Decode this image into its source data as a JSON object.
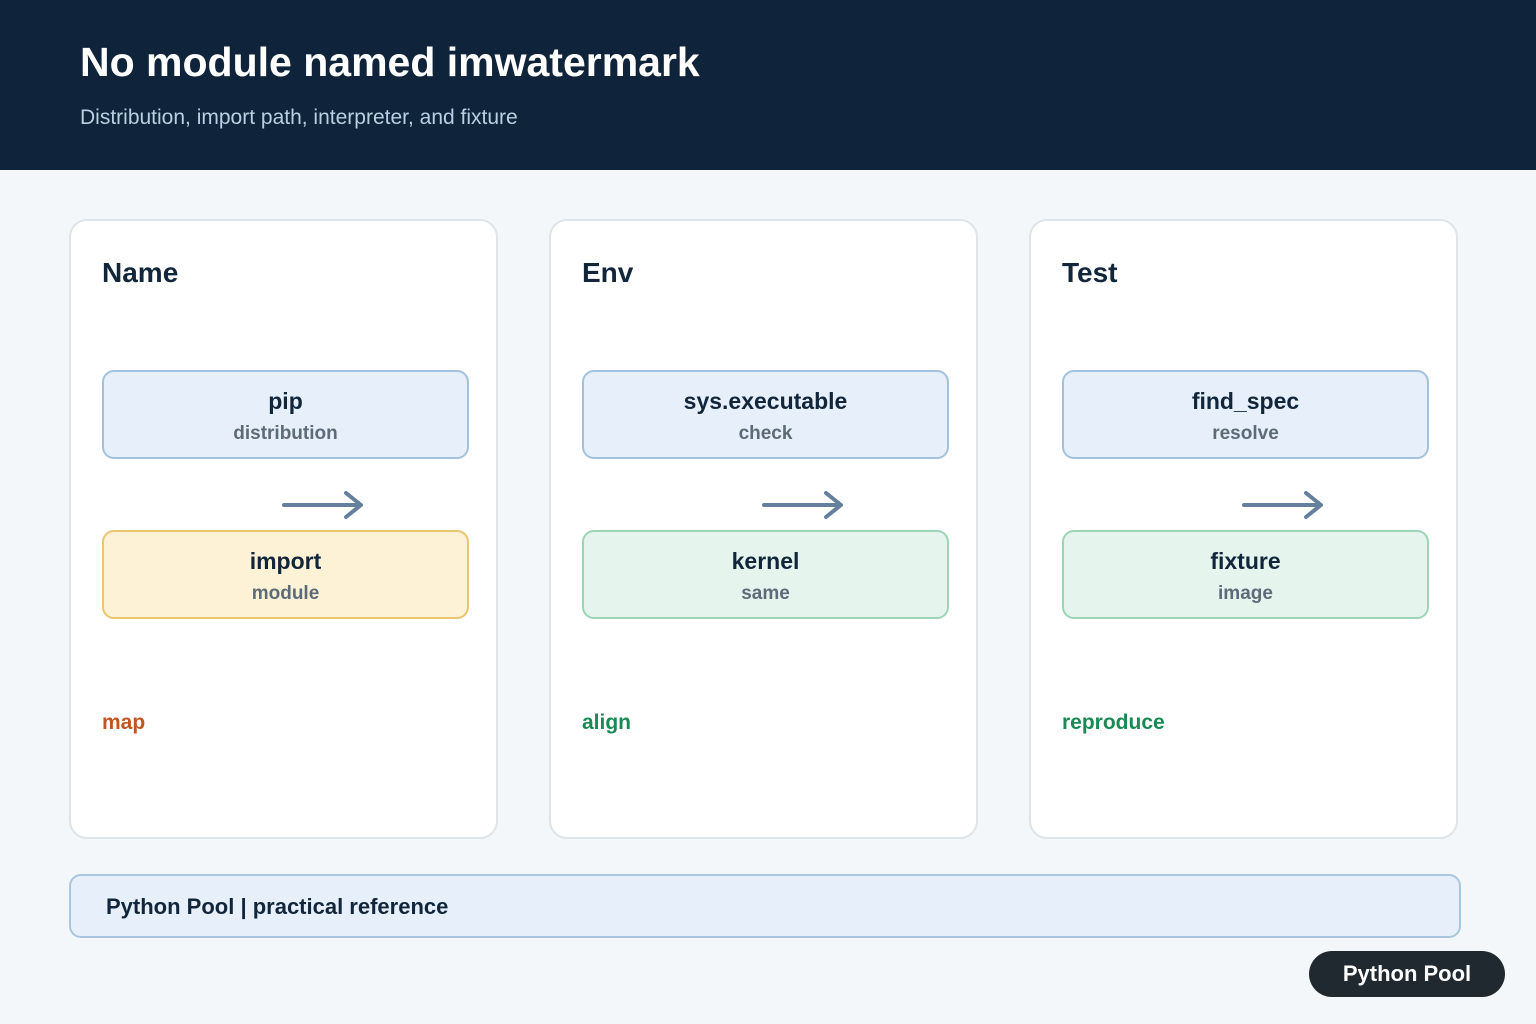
{
  "header": {
    "title": "No module named imwatermark",
    "subtitle": "Distribution, import path, interpreter, and fixture"
  },
  "cards": [
    {
      "title": "Name",
      "top_box": {
        "label": "pip",
        "sub": "distribution"
      },
      "bottom_box": {
        "label": "import",
        "sub": "module"
      },
      "note": "map"
    },
    {
      "title": "Env",
      "top_box": {
        "label": "sys.executable",
        "sub": "check"
      },
      "bottom_box": {
        "label": "kernel",
        "sub": "same"
      },
      "note": "align"
    },
    {
      "title": "Test",
      "top_box": {
        "label": "find_spec",
        "sub": "resolve"
      },
      "bottom_box": {
        "label": "fixture",
        "sub": "image"
      },
      "note": "reproduce"
    }
  ],
  "footer": {
    "text": "Python Pool | practical reference"
  },
  "badge": {
    "text": "Python Pool"
  },
  "colors": {
    "header_bg": "#0f243a",
    "box_blue": "#e7effa",
    "box_yellow": "#fdf2d6",
    "box_green": "#e5f5ee",
    "arrow": "#64809c",
    "note_orange": "#c05621",
    "note_green": "#1a8a55"
  }
}
